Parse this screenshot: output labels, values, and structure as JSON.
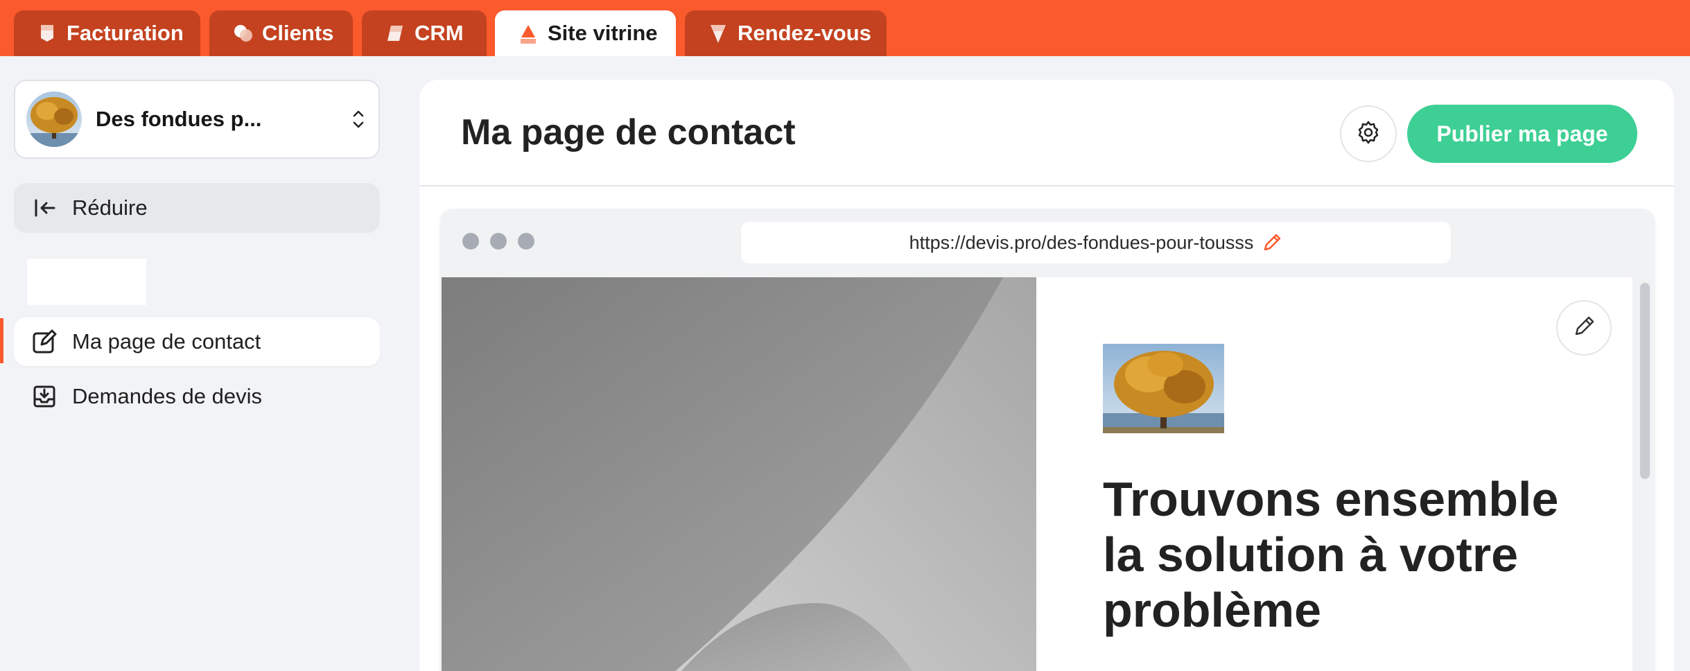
{
  "tabs": [
    {
      "label": "Facturation",
      "icon": "invoice-icon",
      "active": false
    },
    {
      "label": "Clients",
      "icon": "clients-icon",
      "active": false
    },
    {
      "label": "CRM",
      "icon": "crm-icon",
      "active": false
    },
    {
      "label": "Site vitrine",
      "icon": "website-icon",
      "active": true
    },
    {
      "label": "Rendez-vous",
      "icon": "appointment-icon",
      "active": false
    }
  ],
  "sidebar": {
    "org_name": "Des fondues p...",
    "collapse_label": "Réduire",
    "items": [
      {
        "label": "Ma page de contact",
        "icon": "edit-page-icon",
        "active": true
      },
      {
        "label": "Demandes de devis",
        "icon": "inbox-download-icon",
        "active": false
      }
    ]
  },
  "main": {
    "title": "Ma page de contact",
    "publish_label": "Publier ma page",
    "preview": {
      "url": "https://devis.pro/des-fondues-pour-tousss",
      "heading_lines": [
        "Trouvons ensemble",
        "la solution à votre",
        "problème"
      ]
    }
  },
  "colors": {
    "brand_orange": "#fb5a2d",
    "tab_inactive": "#c4421f",
    "publish_green": "#3ecf94",
    "background": "#f2f3f6"
  }
}
